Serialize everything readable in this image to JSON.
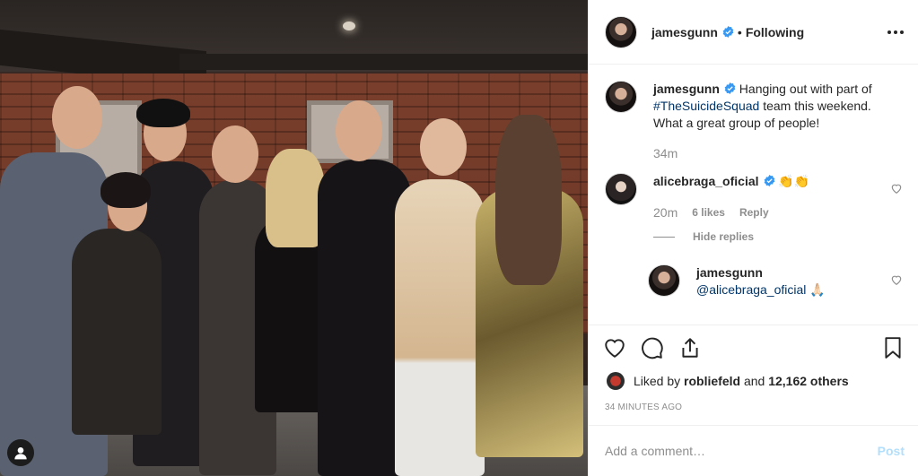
{
  "header": {
    "username": "jamesgunn",
    "separator": "•",
    "follow_status": "Following"
  },
  "caption": {
    "username": "jamesgunn",
    "text_before": "Hanging out with part of ",
    "hashtag": "#TheSuicideSquad",
    "text_after": " team this weekend. What a great group of people!",
    "time": "34m"
  },
  "comments": [
    {
      "username": "alicebraga_oficial",
      "text": "👏👏",
      "time": "20m",
      "likes": "6 likes",
      "reply_label": "Reply",
      "hide_replies": "Hide replies",
      "reply": {
        "username": "jamesgunn",
        "mention": "@alicebraga_oficial",
        "emoji": "🙏🏻"
      }
    }
  ],
  "likes": {
    "prefix": "Liked by ",
    "user": "robliefeld",
    "middle": " and ",
    "others": "12,162 others"
  },
  "timestamp": "34 minutes ago",
  "add_comment": {
    "placeholder": "Add a comment…",
    "post_label": "Post"
  },
  "colors": {
    "verified": "#3897f0",
    "hashtag": "#003569",
    "post_disabled": "#b2dffc",
    "muted": "#8e8e8e"
  },
  "icons": [
    "more-options-icon",
    "verified-icon",
    "heart-icon",
    "comment-icon",
    "share-icon",
    "bookmark-icon",
    "user-tag-icon"
  ]
}
